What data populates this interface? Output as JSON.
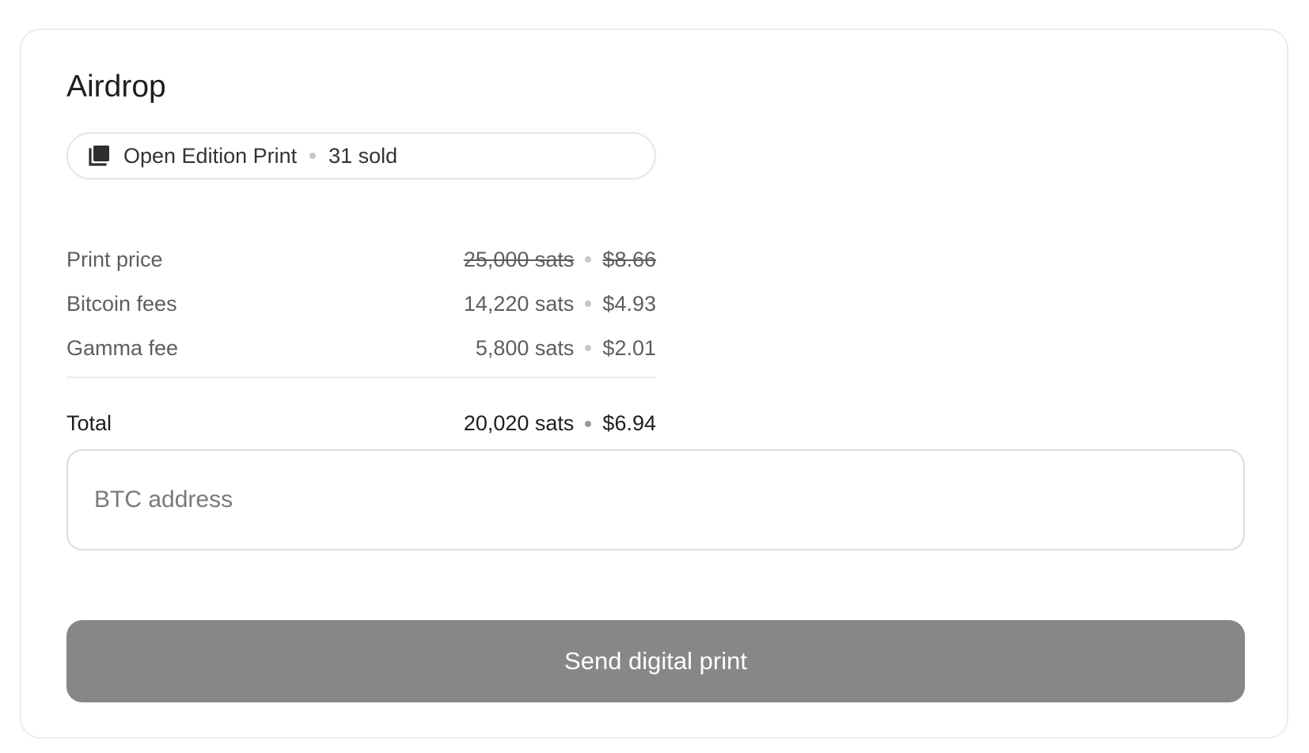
{
  "airdrop": {
    "title": "Airdrop",
    "edition": {
      "icon": "copies-icon",
      "label": "Open Edition Print",
      "sold": "31 sold"
    },
    "line_items": [
      {
        "label": "Print price",
        "sats": "25,000 sats",
        "usd": "$8.66",
        "strikethrough": true
      },
      {
        "label": "Bitcoin fees",
        "sats": "14,220 sats",
        "usd": "$4.93",
        "strikethrough": false
      },
      {
        "label": "Gamma fee",
        "sats": "5,800 sats",
        "usd": "$2.01",
        "strikethrough": false
      }
    ],
    "total": {
      "label": "Total",
      "sats": "20,020 sats",
      "usd": "$6.94"
    },
    "address_input": {
      "placeholder": "BTC address",
      "value": ""
    },
    "submit_label": "Send digital print",
    "colors": {
      "button_bg": "#878787",
      "border": "#ececec",
      "muted_text": "#5e5e5e"
    }
  }
}
